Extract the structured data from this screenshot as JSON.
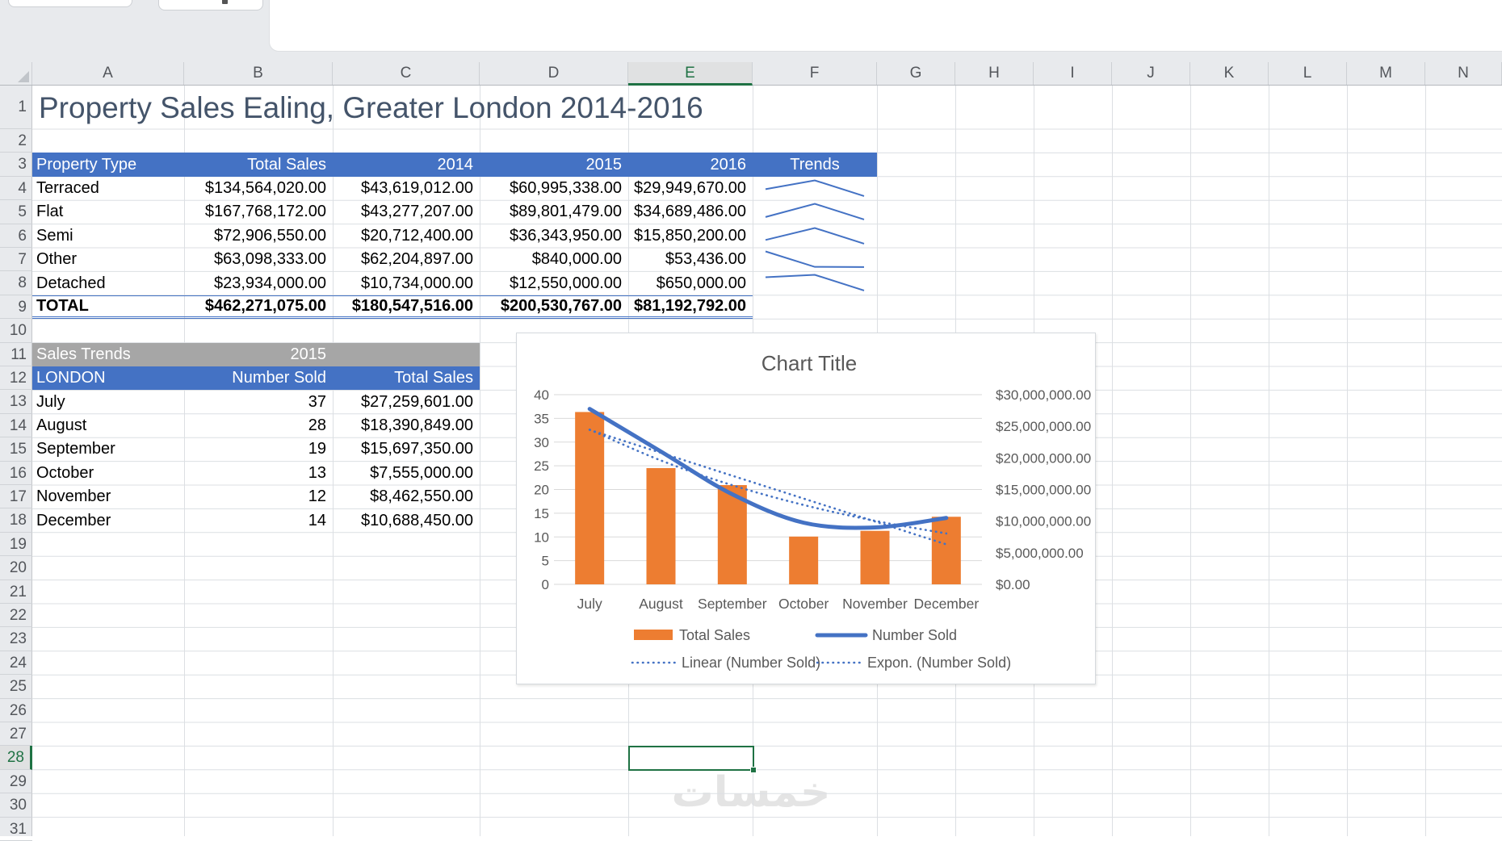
{
  "sheet": {
    "column_labels": [
      "A",
      "B",
      "C",
      "D",
      "E",
      "F",
      "G",
      "H",
      "I",
      "J",
      "K",
      "L",
      "M",
      "N"
    ],
    "row_labels": [
      "1",
      "2",
      "3",
      "4",
      "5",
      "6",
      "7",
      "8",
      "9",
      "10",
      "11",
      "12",
      "13",
      "14",
      "15",
      "16",
      "17",
      "18",
      "19",
      "20",
      "21",
      "22",
      "23",
      "24",
      "25",
      "26",
      "27",
      "28",
      "29",
      "30",
      "31"
    ],
    "selected_column": "E",
    "selected_row": "28",
    "selected_cell": "E28"
  },
  "page_title": "Property Sales Ealing, Greater London 2014-2016",
  "property_table": {
    "headers": [
      "Property Type",
      "Total Sales",
      "2014",
      "2015",
      "2016",
      "Trends"
    ],
    "rows": [
      {
        "type": "Terraced",
        "total": "$134,564,020.00",
        "y2014": "$43,619,012.00",
        "y2015": "$60,995,338.00",
        "y2016": "$29,949,670.00",
        "trend": [
          43619012,
          60995338,
          29949670
        ]
      },
      {
        "type": "Flat",
        "total": "$167,768,172.00",
        "y2014": "$43,277,207.00",
        "y2015": "$89,801,479.00",
        "y2016": "$34,689,486.00",
        "trend": [
          43277207,
          89801479,
          34689486
        ]
      },
      {
        "type": "Semi",
        "total": "$72,906,550.00",
        "y2014": "$20,712,400.00",
        "y2015": "$36,343,950.00",
        "y2016": "$15,850,200.00",
        "trend": [
          20712400,
          36343950,
          15850200
        ]
      },
      {
        "type": "Other",
        "total": "$63,098,333.00",
        "y2014": "$62,204,897.00",
        "y2015": "$840,000.00",
        "y2016": "$53,436.00",
        "trend": [
          62204897,
          840000,
          53436
        ]
      },
      {
        "type": "Detached",
        "total": "$23,934,000.00",
        "y2014": "$10,734,000.00",
        "y2015": "$12,550,000.00",
        "y2016": "$650,000.00",
        "trend": [
          10734000,
          12550000,
          650000
        ]
      }
    ],
    "total_row": {
      "type": "TOTAL",
      "total": "$462,271,075.00",
      "y2014": "$180,547,516.00",
      "y2015": "$200,530,767.00",
      "y2016": "$81,192,792.00"
    }
  },
  "sales_trends_table": {
    "title": "Sales Trends",
    "year": "2015",
    "headers": [
      "LONDON",
      "Number Sold",
      "Total Sales"
    ],
    "rows": [
      {
        "month": "July",
        "sold": "37",
        "sales": "$27,259,601.00"
      },
      {
        "month": "August",
        "sold": "28",
        "sales": "$18,390,849.00"
      },
      {
        "month": "September",
        "sold": "19",
        "sales": "$15,697,350.00"
      },
      {
        "month": "October",
        "sold": "13",
        "sales": "$7,555,000.00"
      },
      {
        "month": "November",
        "sold": "12",
        "sales": "$8,462,550.00"
      },
      {
        "month": "December",
        "sold": "14",
        "sales": "$10,688,450.00"
      }
    ]
  },
  "chart_data": {
    "type": "bar",
    "subtype": "combo bar + smoothed line + dotted trendlines",
    "title": "Chart Title",
    "categories": [
      "July",
      "August",
      "September",
      "October",
      "November",
      "December"
    ],
    "series": [
      {
        "name": "Total Sales",
        "kind": "bar",
        "axis": "right",
        "color": "#ED7D31",
        "values": [
          27259601,
          18390849,
          15697350,
          7555000,
          8462550,
          10688450
        ]
      },
      {
        "name": "Number Sold",
        "kind": "line",
        "axis": "left",
        "color": "#4472C4",
        "values": [
          37,
          28,
          19,
          13,
          12,
          14
        ]
      },
      {
        "name": "Linear (Number Sold)",
        "kind": "dotted",
        "axis": "left",
        "color": "#4472C4",
        "values": [
          32.57,
          27.74,
          22.91,
          18.09,
          13.26,
          8.43
        ]
      },
      {
        "name": "Expon. (Number Sold)",
        "kind": "dotted",
        "axis": "left",
        "color": "#4472C4",
        "values": [
          32.63,
          26.12,
          20.91,
          16.74,
          13.4,
          10.73
        ]
      }
    ],
    "left_axis": {
      "min": 0,
      "max": 40,
      "step": 5,
      "ticks": [
        "40",
        "35",
        "30",
        "25",
        "20",
        "15",
        "10",
        "5",
        "0"
      ]
    },
    "right_axis": {
      "min": 0,
      "max": 30000000,
      "ticks": [
        "$30,000,000.00",
        "$25,000,000.00",
        "$20,000,000.00",
        "$15,000,000.00",
        "$10,000,000.00",
        "$5,000,000.00",
        "$0.00"
      ]
    },
    "legend": [
      "Total Sales",
      "Number Sold",
      "Linear (Number Sold)",
      "Expon. (Number Sold)"
    ],
    "legend_position": "bottom",
    "grid": true
  },
  "watermark": "خمسات",
  "colors": {
    "accent_blue": "#4472C4",
    "accent_orange": "#ED7D31",
    "header_gray": "#A6A6A6",
    "title_text": "#44546A",
    "chart_text": "#595959",
    "selection_green": "#1F7244"
  }
}
